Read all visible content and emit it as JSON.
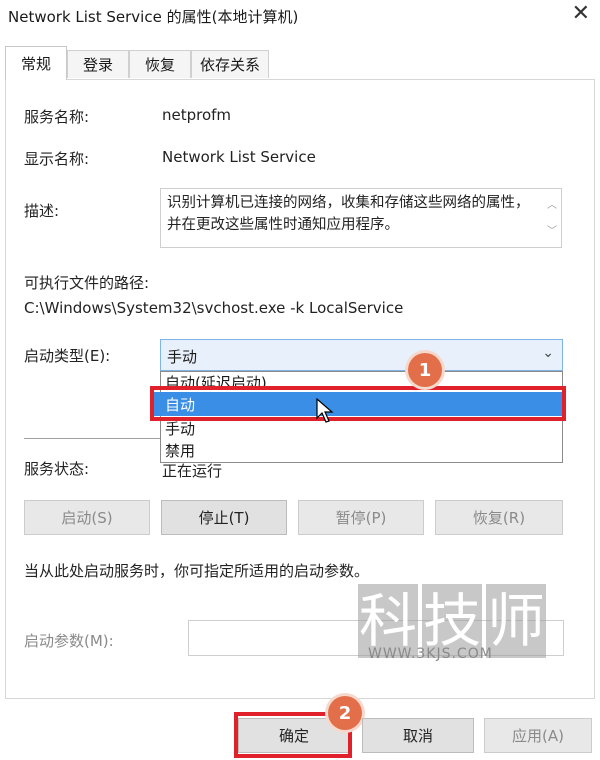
{
  "window": {
    "title": "Network List Service 的属性(本地计算机)",
    "close_glyph": "✕"
  },
  "tabs": [
    {
      "label": "常规",
      "active": true
    },
    {
      "label": "登录",
      "active": false
    },
    {
      "label": "恢复",
      "active": false
    },
    {
      "label": "依存关系",
      "active": false
    }
  ],
  "general": {
    "service_name_label": "服务名称:",
    "service_name_value": "netprofm",
    "display_name_label": "显示名称:",
    "display_name_value": "Network List Service",
    "description_label": "描述:",
    "description_value": "识别计算机已连接的网络，收集和存储这些网络的属性，并在更改这些属性时通知应用程序。",
    "exe_path_label": "可执行文件的路径:",
    "exe_path_value": "C:\\Windows\\System32\\svchost.exe -k LocalService",
    "startup_type_label": "启动类型(E):",
    "startup_type_value": "手动",
    "startup_options": [
      "自动(延迟启动)",
      "自动",
      "手动",
      "禁用"
    ],
    "highlighted_option": "自动",
    "service_status_label": "服务状态:",
    "service_status_value": "正在运行",
    "buttons": {
      "start": "启动(S)",
      "stop": "停止(T)",
      "pause": "暂停(P)",
      "resume": "恢复(R)"
    },
    "hint_text": "当从此处启动服务时，你可指定所适用的启动参数。",
    "start_params_label": "启动参数(M):"
  },
  "footer": {
    "ok": "确定",
    "cancel": "取消",
    "apply": "应用(A)"
  },
  "annotations": {
    "step1": "1",
    "step2": "2",
    "highlight_color": "#e0202a",
    "badge_color": "#e26f4a"
  },
  "watermark": {
    "chars": [
      "科",
      "技",
      "师"
    ],
    "url": "WWW.3KJS.COM"
  }
}
